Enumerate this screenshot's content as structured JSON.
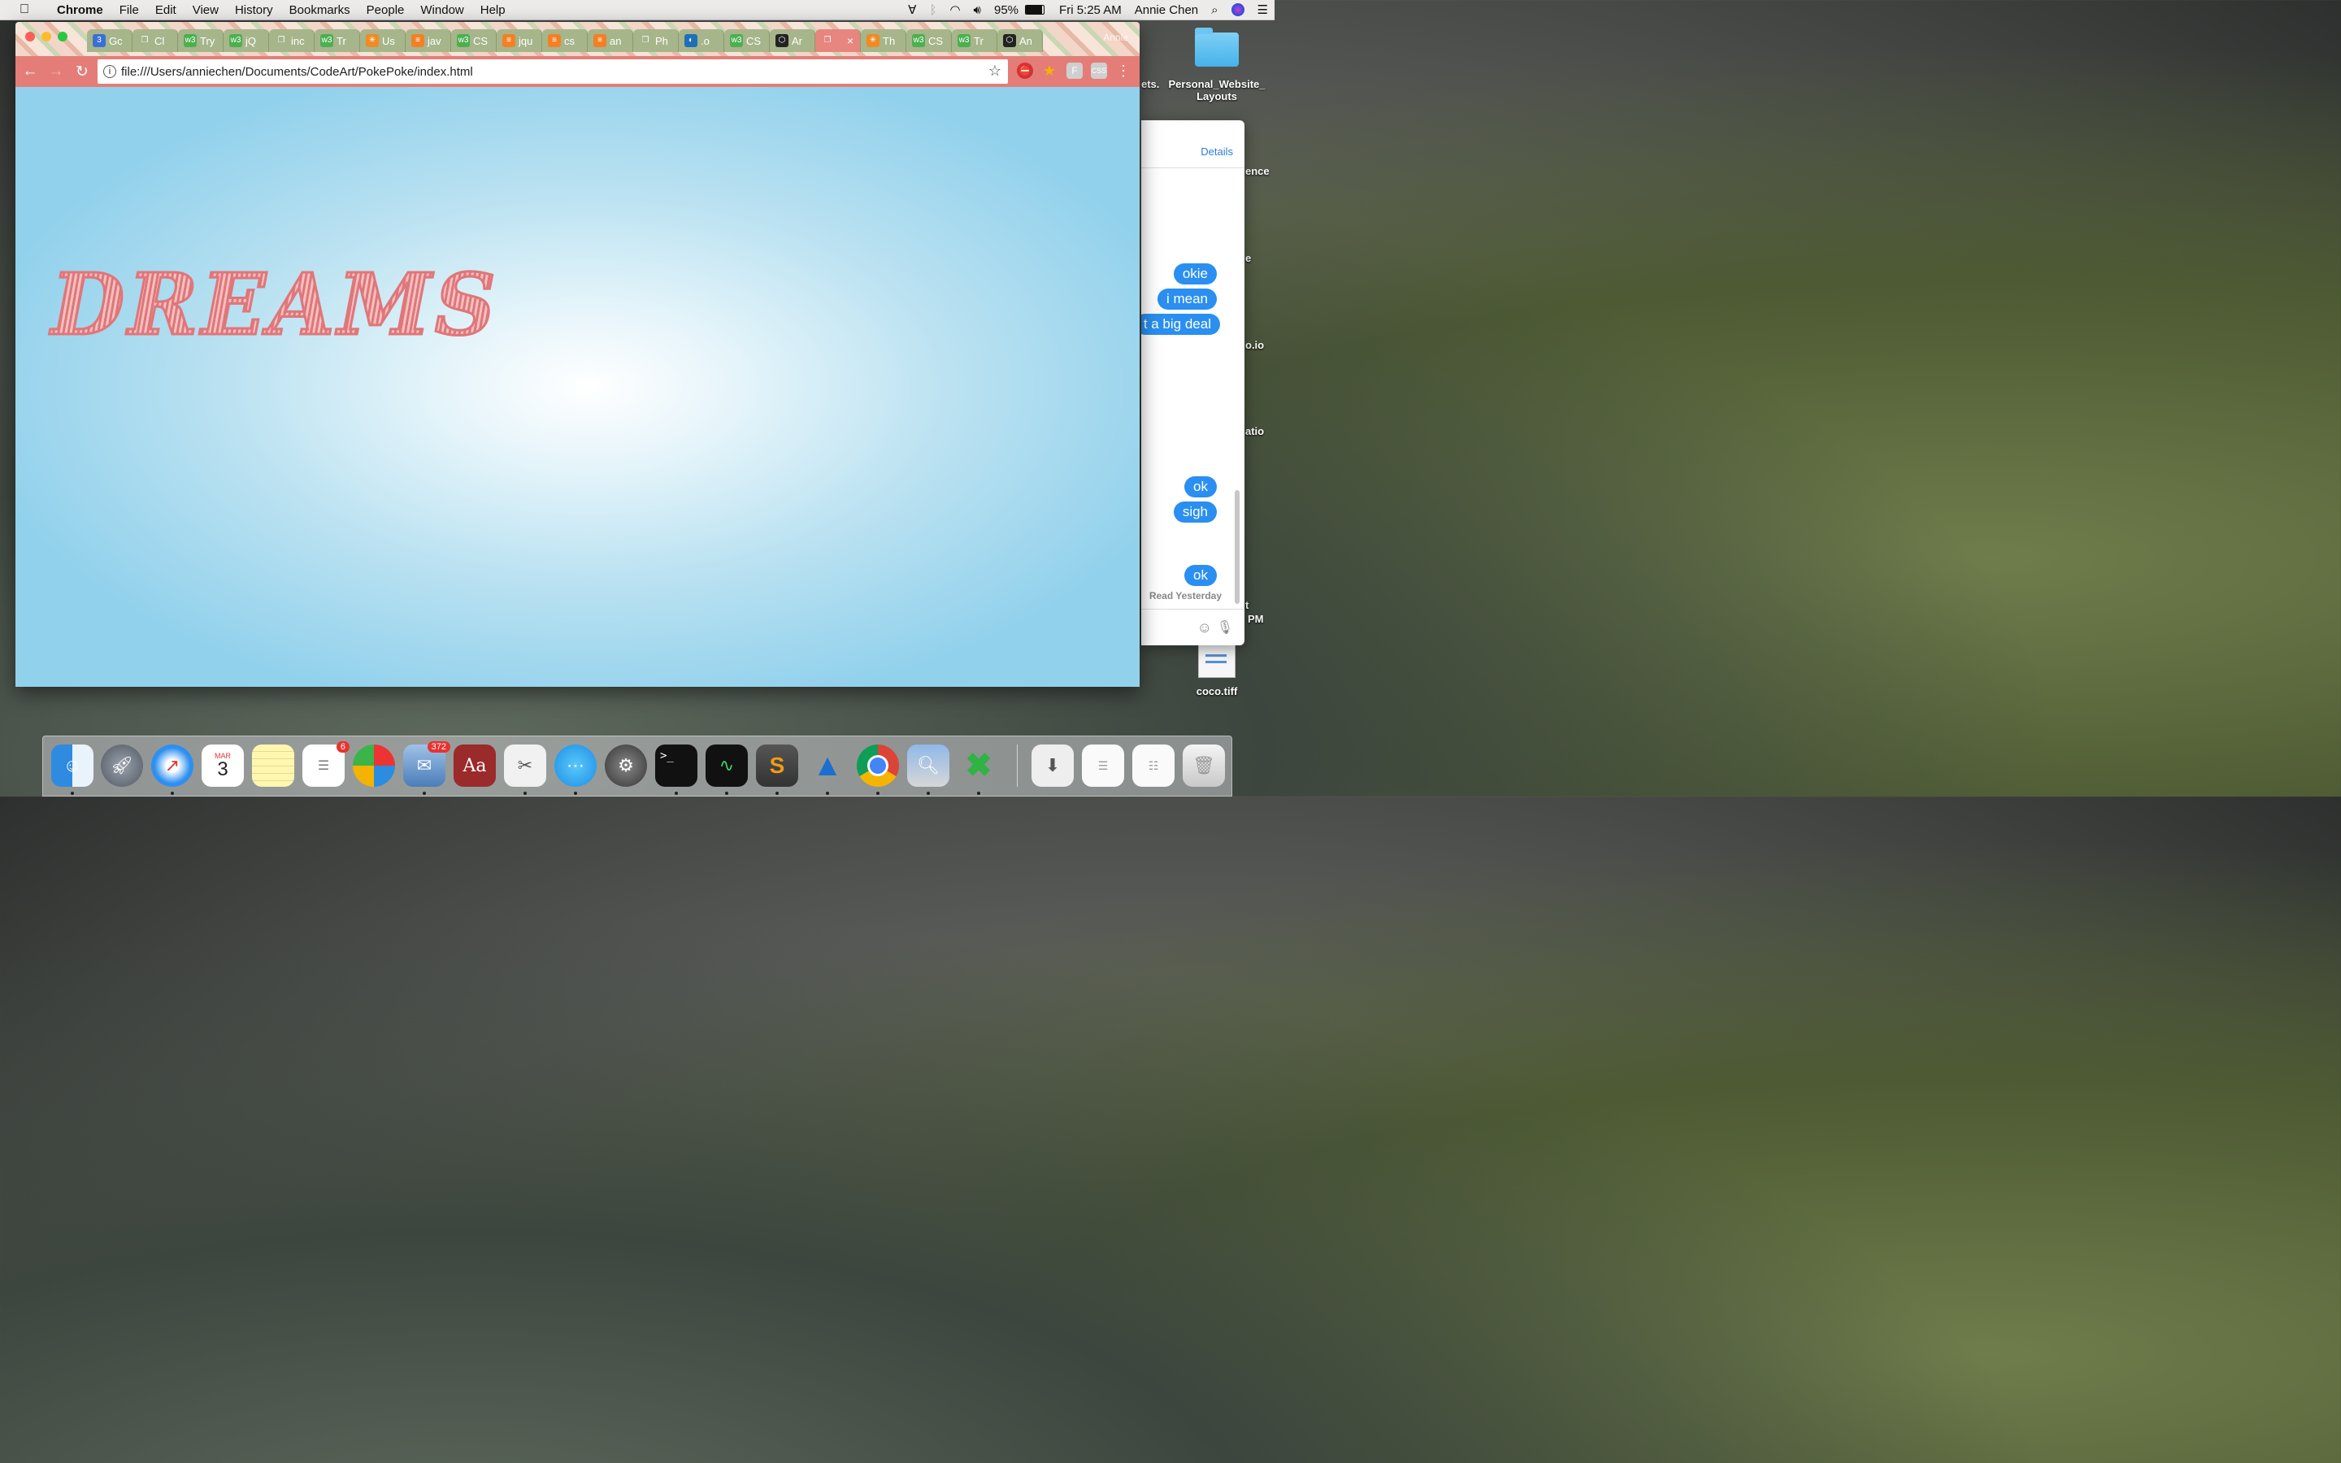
{
  "menubar": {
    "app": "Chrome",
    "items": [
      "File",
      "Edit",
      "View",
      "History",
      "Bookmarks",
      "People",
      "Window",
      "Help"
    ],
    "battery": "95%",
    "clock": "Fri 5:25 AM",
    "user": "Annie Chen"
  },
  "browser": {
    "tabs": [
      {
        "label": "Gc",
        "icon": "calendar-icon",
        "color": "#3b6fd8"
      },
      {
        "label": "Cl",
        "icon": "page-icon",
        "color": "#a7b58b"
      },
      {
        "label": "Try",
        "icon": "w3-icon",
        "color": "#4caf50"
      },
      {
        "label": "jQ",
        "icon": "w3-icon",
        "color": "#4caf50"
      },
      {
        "label": "inc",
        "icon": "page-icon",
        "color": "#a7b58b"
      },
      {
        "label": "Tr",
        "icon": "w3-icon",
        "color": "#4caf50"
      },
      {
        "label": "Us",
        "icon": "asterisk-icon",
        "color": "#f08a24"
      },
      {
        "label": "jav",
        "icon": "stack-icon",
        "color": "#f48024"
      },
      {
        "label": "CS",
        "icon": "w3-icon",
        "color": "#4caf50"
      },
      {
        "label": "jqu",
        "icon": "stack-icon",
        "color": "#f48024"
      },
      {
        "label": "cs",
        "icon": "stack-icon",
        "color": "#f48024"
      },
      {
        "label": "an",
        "icon": "stack-icon",
        "color": "#f48024"
      },
      {
        "label": "Ph",
        "icon": "page-icon",
        "color": "#a7b58b"
      },
      {
        "label": ".o",
        "icon": "jquery-icon",
        "color": "#1d6fb8"
      },
      {
        "label": "CS",
        "icon": "w3-icon",
        "color": "#4caf50"
      },
      {
        "label": "Ar",
        "icon": "codepen-icon",
        "color": "#222222"
      },
      {
        "label": "",
        "icon": "page-icon",
        "color": "#e7857f",
        "active": true
      },
      {
        "label": "Th",
        "icon": "asterisk-icon",
        "color": "#f08a24"
      },
      {
        "label": "CS",
        "icon": "w3-icon",
        "color": "#4caf50"
      },
      {
        "label": "Tr",
        "icon": "w3-icon",
        "color": "#4caf50"
      },
      {
        "label": "An",
        "icon": "codepen-icon",
        "color": "#222222"
      }
    ],
    "profile": "Annie",
    "url": "file:///Users/anniechen/Documents/CodeArt/PokePoke/index.html",
    "page_heading": "DREAMS"
  },
  "messages": {
    "details": "Details",
    "bubbles": [
      "okie",
      "i mean",
      "t a big deal",
      "ok",
      "sigh",
      "ok"
    ],
    "read_status": "Read Yesterday"
  },
  "desktop": {
    "folder_label": "Personal_Website_ Layouts",
    "side_fragments": [
      "ets.",
      "ence",
      "e",
      "o.io",
      "atio",
      "t",
      "PM"
    ],
    "file_label": "coco.tiff"
  },
  "dock": {
    "calendar_month": "MAR",
    "calendar_day": "3",
    "reminders_badge": "6",
    "mail_badge": "372",
    "dictionary_label": "Aa",
    "terminal_prompt": ">_"
  }
}
